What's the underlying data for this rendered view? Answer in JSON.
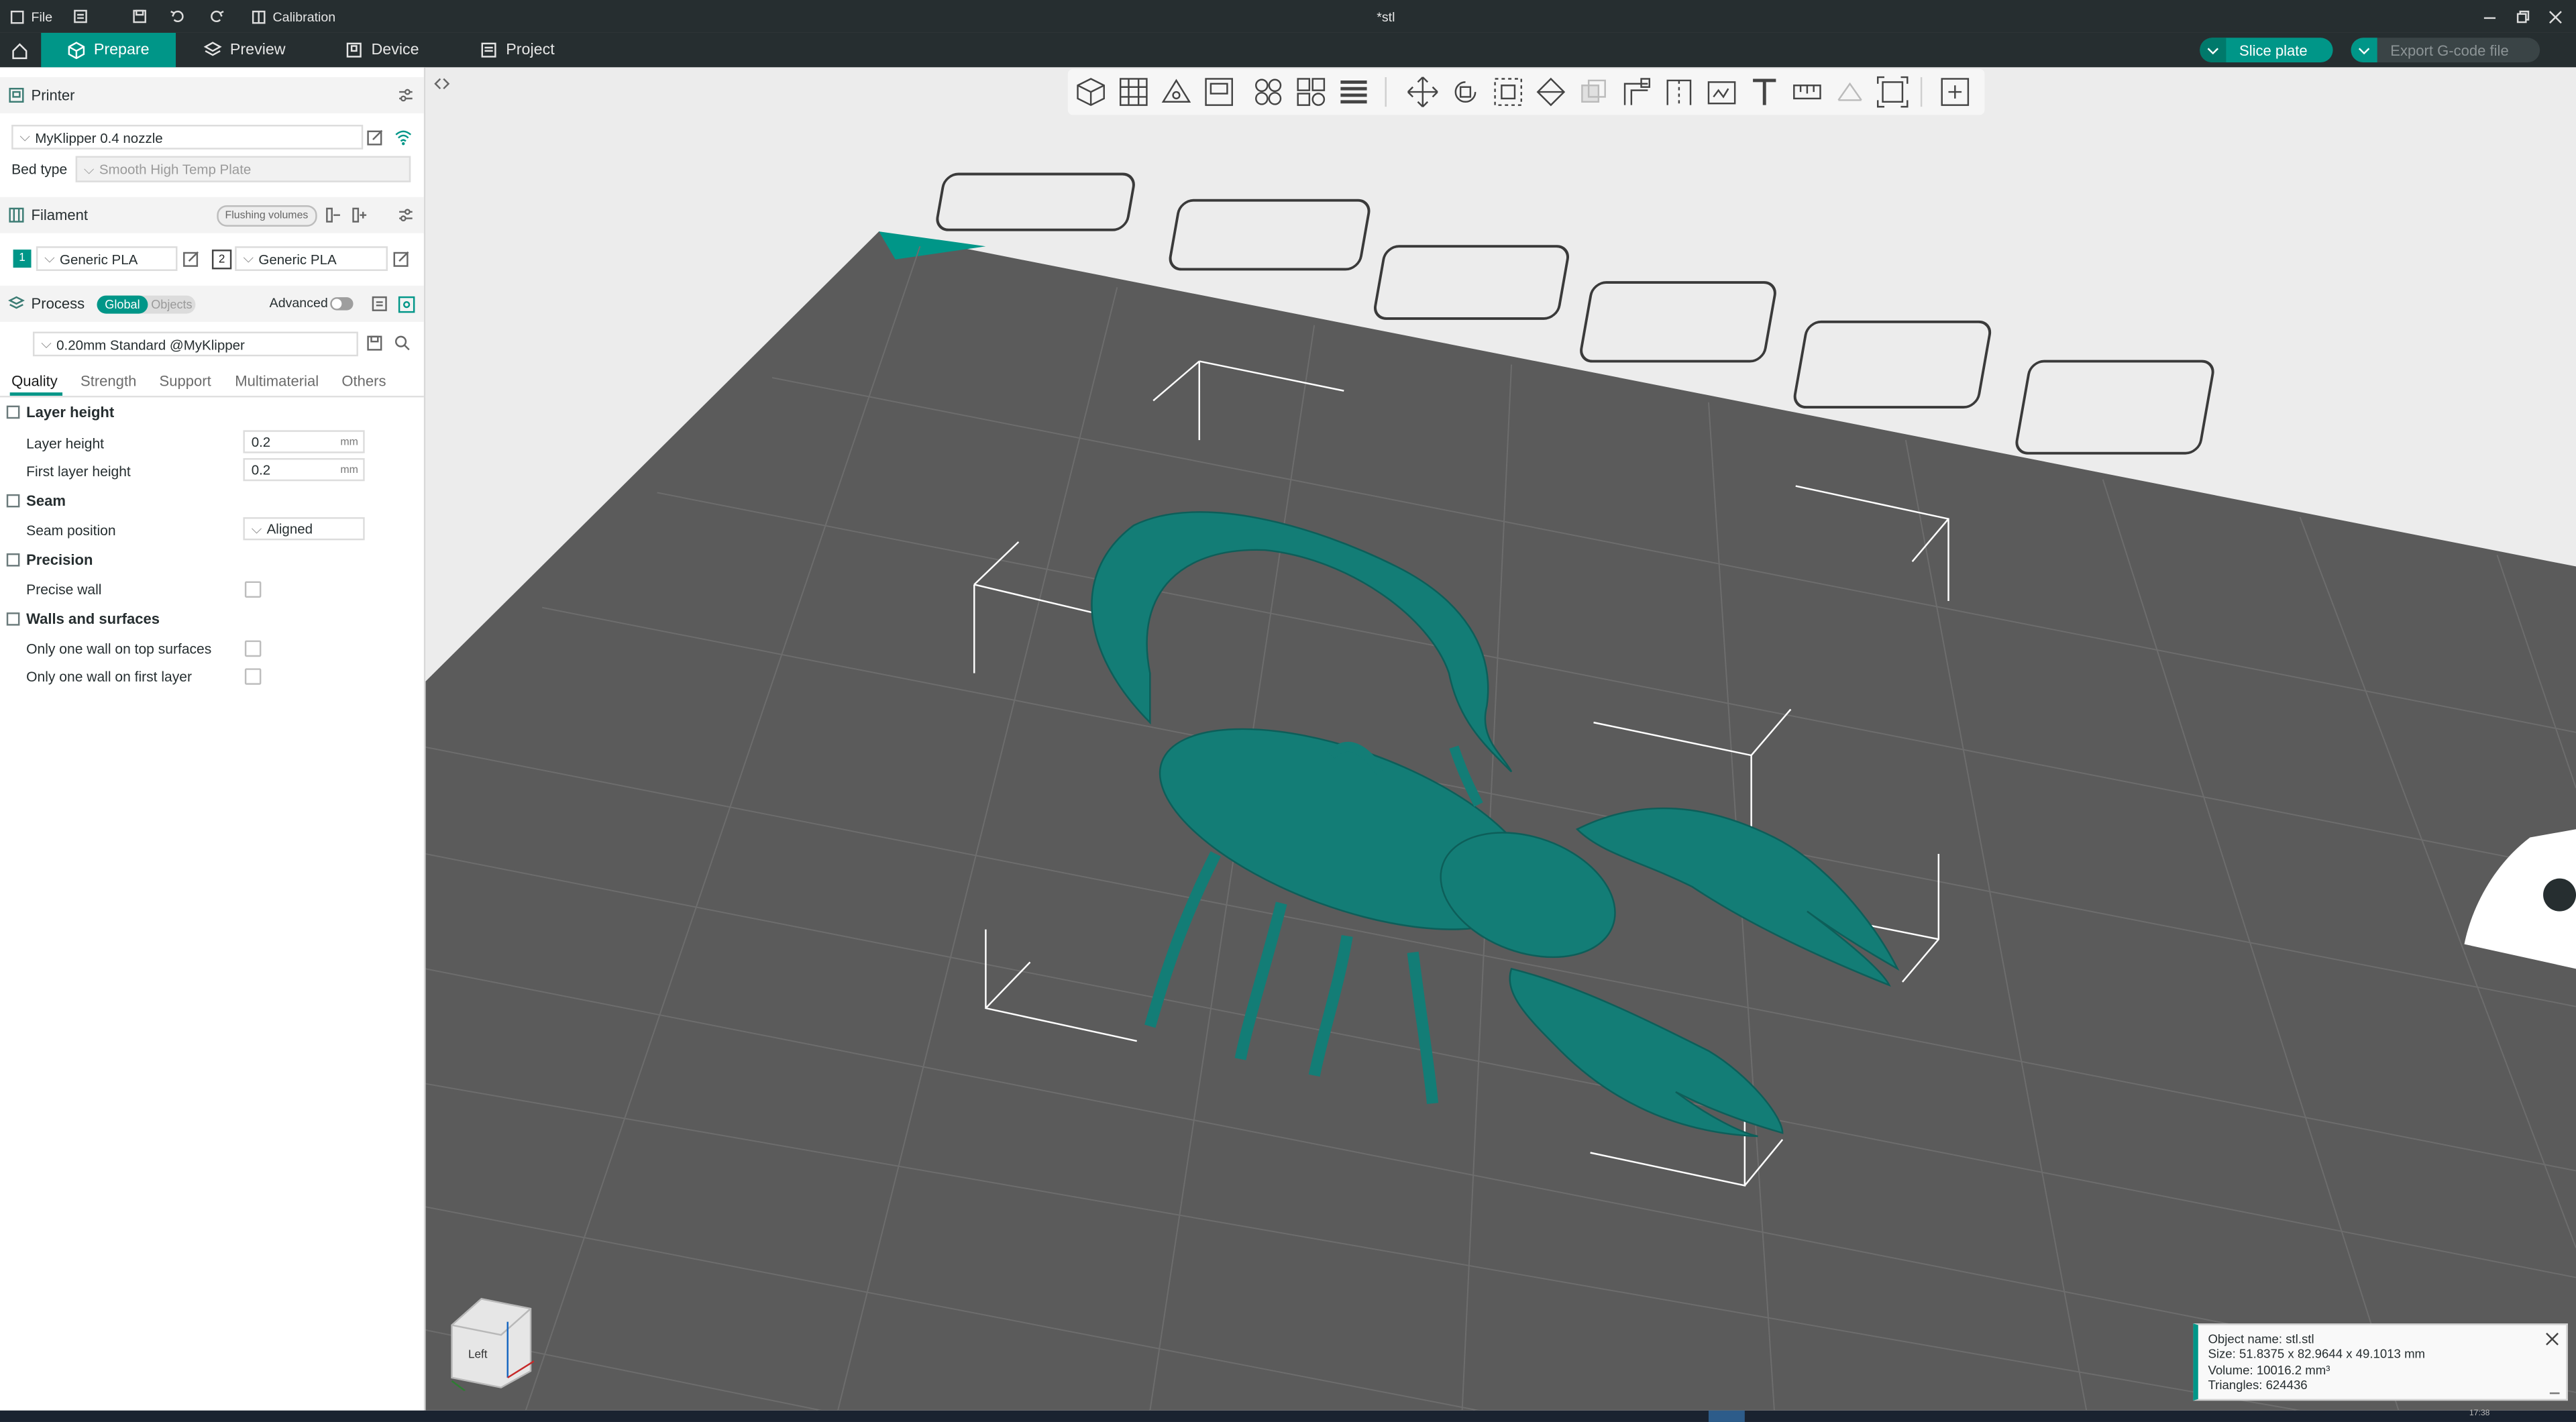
{
  "titlebar": {
    "file_label": "File",
    "calibration_label": "Calibration",
    "window_title": "*stl"
  },
  "tabs": {
    "prepare": "Prepare",
    "preview": "Preview",
    "device": "Device",
    "project": "Project"
  },
  "actions": {
    "slice_plate": "Slice plate",
    "export_gcode": "Export G-code file"
  },
  "printer": {
    "section_label": "Printer",
    "selected_printer": "MyKlipper 0.4 nozzle",
    "bed_type_label": "Bed type",
    "bed_type_value": "Smooth High Temp Plate"
  },
  "filament": {
    "section_label": "Filament",
    "flushing_button": "Flushing volumes",
    "slots": [
      {
        "index": "1",
        "name": "Generic PLA"
      },
      {
        "index": "2",
        "name": "Generic PLA"
      }
    ]
  },
  "process": {
    "section_label": "Process",
    "toggle_global": "Global",
    "toggle_objects": "Objects",
    "advanced_label": "Advanced",
    "preset": "0.20mm Standard @MyKlipper",
    "tabs": [
      "Quality",
      "Strength",
      "Support",
      "Multimaterial",
      "Others"
    ]
  },
  "quality": {
    "layer_height_group": "Layer height",
    "layer_height_label": "Layer height",
    "layer_height_value": "0.2",
    "first_layer_height_label": "First layer height",
    "first_layer_height_value": "0.2",
    "unit": "mm",
    "seam_group": "Seam",
    "seam_position_label": "Seam position",
    "seam_position_value": "Aligned",
    "precision_group": "Precision",
    "precise_wall_label": "Precise wall",
    "walls_group": "Walls and surfaces",
    "only_one_wall_top_label": "Only one wall on top surfaces",
    "only_one_wall_first_label": "Only one wall on first layer"
  },
  "view_cube": {
    "face_label": "Left"
  },
  "object_info": {
    "name": "Object name: stl.stl",
    "size": "Size: 51.8375 x 82.9644 x 49.1013 mm",
    "volume": "Volume: 10016.2 mm³",
    "triangles": "Triangles: 624436"
  },
  "taskbar": {
    "clock": "17:38"
  },
  "colors": {
    "accent": "#009688",
    "model": "#137d76",
    "bed": "#5c5c5c",
    "chrome": "#262e30"
  }
}
